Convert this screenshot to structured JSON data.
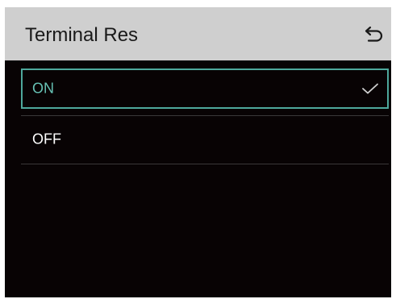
{
  "header": {
    "title": "Terminal Res",
    "back_icon": "return-arrow-icon"
  },
  "options": [
    {
      "label": "ON",
      "selected": true,
      "check_icon": "checkmark-icon"
    },
    {
      "label": "OFF",
      "selected": false
    }
  ],
  "colors": {
    "header_bg": "#cfcfcf",
    "screen_bg": "#080304",
    "accent": "#4ea89c",
    "selected_text": "#67c2b5",
    "text": "#ffffff",
    "divider": "#3a3839"
  }
}
